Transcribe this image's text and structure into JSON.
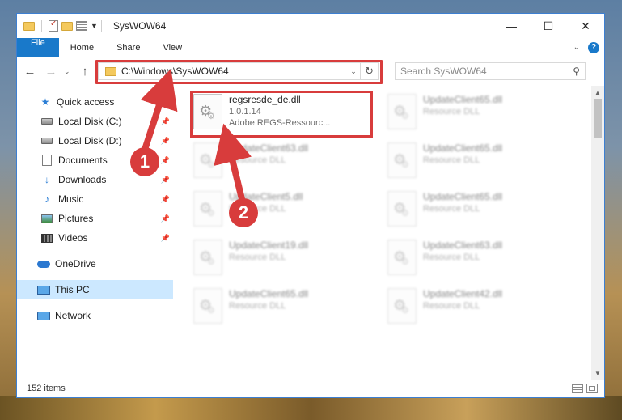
{
  "window": {
    "title": "SysWOW64"
  },
  "titlebar_buttons": [
    "—",
    "☐",
    "✕"
  ],
  "ribbon": {
    "tabs": [
      "File",
      "Home",
      "Share",
      "View"
    ],
    "chevron": "⌄",
    "help": "?"
  },
  "nav": {
    "back": "←",
    "forward": "→",
    "recent": "⌄",
    "up": "↑"
  },
  "address": {
    "path": "C:\\Windows\\SysWOW64",
    "dropdown": "⌄",
    "refresh": "↻"
  },
  "search": {
    "placeholder": "Search SysWOW64"
  },
  "sidebar": {
    "items": [
      {
        "label": "Quick access",
        "icon": "star-icon"
      },
      {
        "label": "Local Disk (C:)",
        "icon": "disk-icon",
        "pinned": true
      },
      {
        "label": "Local Disk (D:)",
        "icon": "disk-icon",
        "pinned": true
      },
      {
        "label": "Documents",
        "icon": "documents-icon",
        "pinned": true
      },
      {
        "label": "Downloads",
        "icon": "download-icon",
        "pinned": true
      },
      {
        "label": "Music",
        "icon": "music-icon",
        "pinned": true
      },
      {
        "label": "Pictures",
        "icon": "pictures-icon",
        "pinned": true
      },
      {
        "label": "Videos",
        "icon": "videos-icon",
        "pinned": true
      },
      {
        "label": "OneDrive",
        "icon": "onedrive-icon"
      },
      {
        "label": "This PC",
        "icon": "pc-icon",
        "selected": true
      },
      {
        "label": "Network",
        "icon": "network-icon"
      }
    ]
  },
  "files": [
    {
      "name": "regsresde_de.dll",
      "line2": "1.0.1.14",
      "line3": "Adobe REGS-Ressourc...",
      "highlighted": true
    },
    {
      "name": "UpdateClient65.dll",
      "line2": "Resource DLL"
    },
    {
      "name": "UpdateClient63.dll",
      "line2": "Resource DLL"
    },
    {
      "name": "UpdateClient65.dll",
      "line2": "Resource DLL"
    },
    {
      "name": "UpdateClient5.dll",
      "line2": "Resource DLL"
    },
    {
      "name": "UpdateClient65.dll",
      "line2": "Resource DLL"
    },
    {
      "name": "UpdateClient19.dll",
      "line2": "Resource DLL"
    },
    {
      "name": "UpdateClient63.dll",
      "line2": "Resource DLL"
    },
    {
      "name": "UpdateClient65.dll",
      "line2": "Resource DLL"
    },
    {
      "name": "UpdateClient42.dll",
      "line2": "Resource DLL"
    }
  ],
  "status": {
    "count": "152 items"
  },
  "callouts": {
    "one": "1",
    "two": "2"
  },
  "colors": {
    "accent": "#1979ca",
    "highlight": "#d83c3c",
    "selected_nav": "#cce8ff"
  }
}
